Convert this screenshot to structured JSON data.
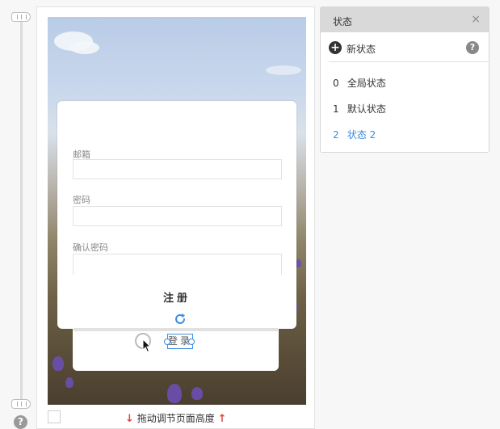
{
  "form": {
    "email_label": "邮箱",
    "password_label": "密码",
    "confirm_password_label": "确认密码",
    "register_label": "注册",
    "login_label": "登录"
  },
  "bottom_bar": {
    "drag_hint": "拖动调节页面高度"
  },
  "states_panel": {
    "title": "状态",
    "close_glyph": "×",
    "new_state_label": "新状态",
    "help_glyph": "?",
    "items": [
      {
        "index": "0",
        "label": "全局状态",
        "active": false
      },
      {
        "index": "1",
        "label": "默认状态",
        "active": false
      },
      {
        "index": "2",
        "label": "状态 2",
        "active": true
      }
    ]
  },
  "sidebar": {
    "help_glyph": "?"
  },
  "colors": {
    "accent": "#3b8de0",
    "arrow": "#e0463b",
    "panel_header": "#d9d9d9"
  },
  "icons": [
    "slider-handle-icon",
    "help-icon",
    "refresh-icon",
    "close-icon",
    "add-circle-icon",
    "cursor-icon",
    "arrow-down-icon",
    "arrow-up-icon"
  ]
}
